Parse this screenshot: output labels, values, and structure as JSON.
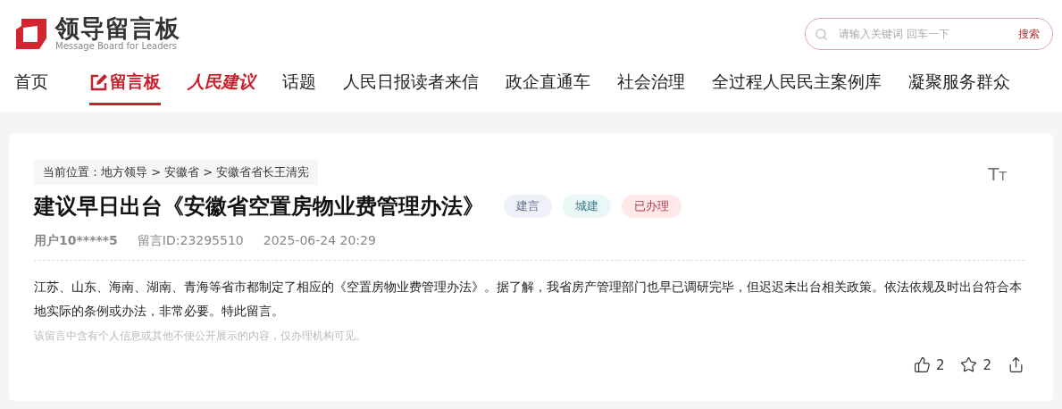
{
  "logo": {
    "title": "领导留言板",
    "subtitle": "Message Board for Leaders"
  },
  "search": {
    "placeholder": "请输入关键词 回车一下",
    "button": "搜索"
  },
  "nav": [
    {
      "label": "首页",
      "kind": "plain",
      "selected": false
    },
    {
      "label": "留言板",
      "kind": "board",
      "selected": true
    },
    {
      "label": "人民建议",
      "kind": "brand",
      "selected": false
    },
    {
      "label": "话题",
      "kind": "plain",
      "selected": false
    },
    {
      "label": "人民日报读者来信",
      "kind": "plain",
      "selected": false
    },
    {
      "label": "政企直通车",
      "kind": "plain",
      "selected": false
    },
    {
      "label": "社会治理",
      "kind": "plain",
      "selected": false
    },
    {
      "label": "全过程人民民主案例库",
      "kind": "plain",
      "selected": false
    },
    {
      "label": "凝聚服务群众",
      "kind": "plain",
      "selected": false
    }
  ],
  "breadcrumb": "当前位置：地方领导 > 安徽省 > 安徽省省长王清宪",
  "font_size_button": "TT",
  "title": "建议早日出台《安徽省空置房物业费管理办法》",
  "tags": [
    {
      "label": "建言",
      "color": "#eef2f8"
    },
    {
      "label": "城建",
      "color": "#e9f8f7"
    },
    {
      "label": "已办理",
      "color": "#fde8ea"
    }
  ],
  "meta": {
    "user": "用户10*****5",
    "message_id": "留言ID:23295510",
    "time": "2025-06-24 20:29"
  },
  "body": "江苏、山东、海南、湖南、青海等省市都制定了相应的《空置房物业费管理办法》。据了解，我省房产管理部门也早已调研完毕，但迟迟未出台相关政策。依法依规及时出台符合本地实际的条例或办法，非常必要。特此留言。",
  "notice": "该留言中含有个人信息或其他不便公开展示的内容，仅办理机构可见。",
  "actions": [
    {
      "kind": "like",
      "count": "2"
    },
    {
      "kind": "star",
      "count": "2"
    },
    {
      "kind": "share"
    }
  ]
}
